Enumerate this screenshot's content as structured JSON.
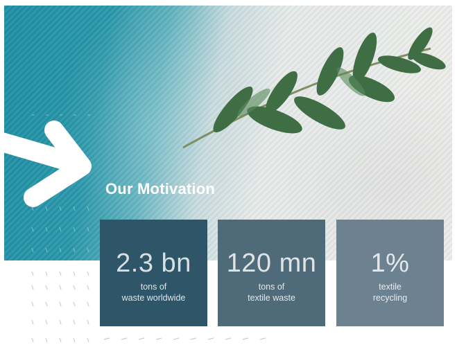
{
  "section": {
    "title": "Our Motivation"
  },
  "stats": [
    {
      "value": "2.3 bn",
      "caption": "tons of\nwaste worldwide"
    },
    {
      "value": "120 mn",
      "caption": "tons of\ntextile waste"
    },
    {
      "value": "1%",
      "caption": "textile\nrecycling"
    }
  ],
  "colors": {
    "teal": "#1d8fa3",
    "card_dark": "#2e5568",
    "card_mid": "#4f6a79",
    "card_light": "#6d8290"
  },
  "icons": [
    "arrow-right-icon",
    "leaf-branch-illustration"
  ]
}
